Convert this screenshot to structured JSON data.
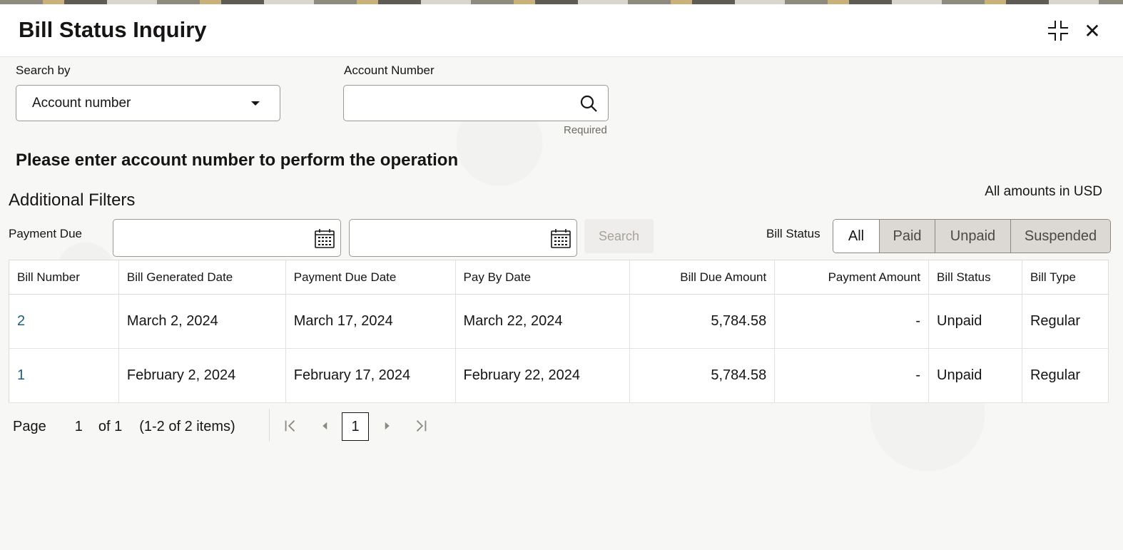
{
  "window": {
    "title": "Bill Status Inquiry"
  },
  "search": {
    "search_by_label": "Search by",
    "search_by_value": "Account number",
    "account_label": "Account Number",
    "account_value": "",
    "required_text": "Required"
  },
  "message": "Please enter account number to perform the operation",
  "filters": {
    "title": "Additional Filters",
    "amounts_note": "All amounts in USD",
    "payment_due_label": "Payment Due",
    "from_date": "",
    "to_date": "",
    "search_label": "Search",
    "bill_status_label": "Bill Status",
    "status_options": [
      "All",
      "Paid",
      "Unpaid",
      "Suspended"
    ],
    "selected_status": "All"
  },
  "table": {
    "headers": [
      "Bill Number",
      "Bill Generated Date",
      "Payment Due Date",
      "Pay By Date",
      "Bill Due Amount",
      "Payment Amount",
      "Bill Status",
      "Bill Type"
    ],
    "rows": [
      [
        "2",
        "March 2, 2024",
        "March 17, 2024",
        "March 22, 2024",
        "5,784.58",
        "-",
        "Unpaid",
        "Regular"
      ],
      [
        "1",
        "February 2, 2024",
        "February 17, 2024",
        "February 22, 2024",
        "5,784.58",
        "-",
        "Unpaid",
        "Regular"
      ]
    ]
  },
  "pagination": {
    "page_label": "Page",
    "current_page": "1",
    "of_text": "of 1",
    "items_text": "(1-2 of 2 items)"
  },
  "icons": {
    "collapse": "collapse-icon",
    "close": "close-icon",
    "search": "search-icon",
    "calendar": "calendar-icon",
    "dropdown": "chevron-down-icon"
  },
  "colors": {
    "link": "#1f5f7a",
    "border": "#9e9a93",
    "segment_inactive": "#dcd9d5"
  }
}
